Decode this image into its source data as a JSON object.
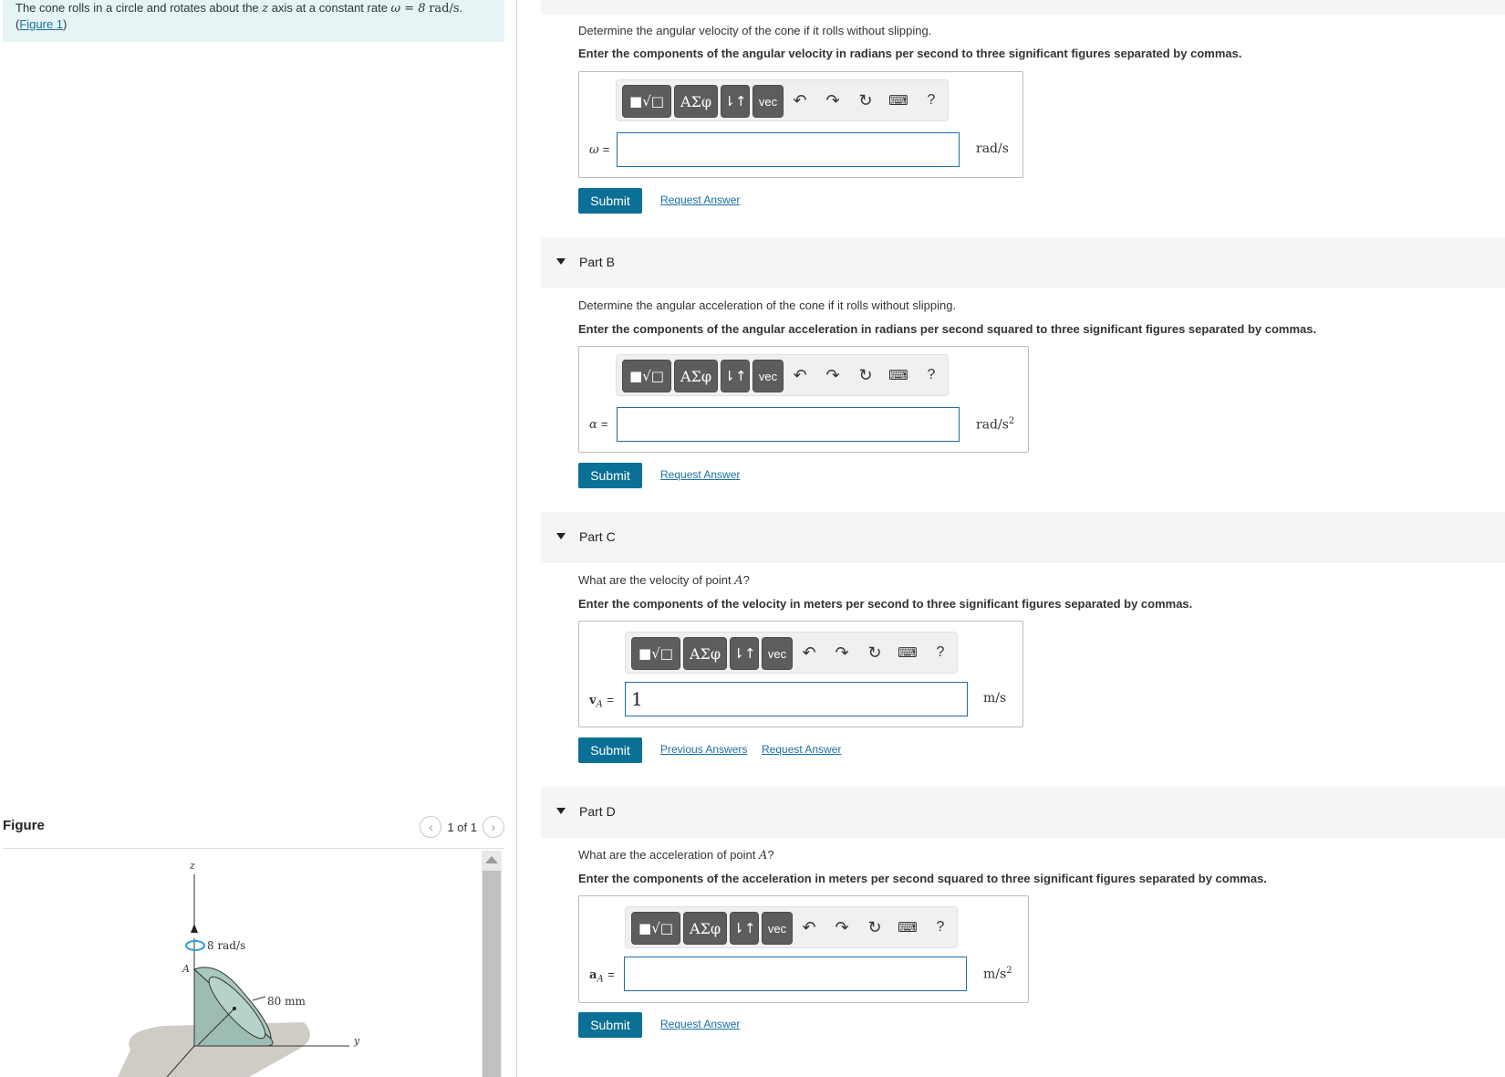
{
  "intro": {
    "text_before": "The cone rolls in a circle and rotates about the ",
    "axis_var": "z",
    "text_mid": " axis at a constant rate ",
    "omega_expr": "ω = 8",
    "omega_unit": "rad/s",
    "period": ".",
    "figure_link_open": "(",
    "figure_link": "Figure 1",
    "figure_link_close": ")"
  },
  "figure": {
    "title": "Figure",
    "page_indicator": "1 of 1",
    "prev_icon": "chevron-left-icon",
    "next_icon": "chevron-right-icon",
    "labels": {
      "z_axis": "z",
      "y_axis": "y",
      "point": "A",
      "rate": "8 rad/s",
      "dimension": "80 mm"
    }
  },
  "toolbar": {
    "templates_label": "■√□",
    "greek_label": "ΑΣφ",
    "subscript_label": "⇂↑",
    "vec_label": "vec",
    "undo_icon": "undo-icon",
    "redo_icon": "redo-icon",
    "reset_icon": "reset-icon",
    "keyboard_icon": "keyboard-icon",
    "help_label": "?"
  },
  "part_a": {
    "question": "Determine the angular velocity of the cone if it rolls without slipping.",
    "instruction": "Enter the components of the angular velocity in radians per second to three significant figures separated by commas.",
    "variable": "ω",
    "eq": "=",
    "value": "",
    "unit": "rad/s",
    "submit": "Submit",
    "request": "Request Answer"
  },
  "part_b": {
    "title": "Part B",
    "question": "Determine the angular acceleration of the cone if it rolls without slipping.",
    "instruction": "Enter the components of the angular acceleration in radians per second squared to three significant figures separated by commas.",
    "variable": "α",
    "eq": "=",
    "value": "",
    "unit": "rad/s",
    "unit_exp": "2",
    "submit": "Submit",
    "request": "Request Answer"
  },
  "part_c": {
    "title": "Part C",
    "question_before": "What are the velocity of point ",
    "question_var": "A",
    "question_after": "?",
    "instruction": "Enter the components of the velocity in meters per second to three significant figures separated by commas.",
    "variable": "v",
    "variable_sub": "A",
    "eq": "=",
    "value": "1",
    "unit": "m/s",
    "submit": "Submit",
    "previous": "Previous Answers",
    "request": "Request Answer"
  },
  "part_d": {
    "title": "Part D",
    "question_before": "What are the acceleration of point ",
    "question_var": "A",
    "question_after": "?",
    "instruction": "Enter the components of the acceleration in meters per second squared to three significant figures separated by commas.",
    "variable": "a",
    "variable_sub": "A",
    "eq": "=",
    "value": "",
    "unit": "m/s",
    "unit_exp": "2",
    "submit": "Submit",
    "request": "Request Answer"
  },
  "colors": {
    "submit_bg": "#0b7095",
    "link": "#1a6fa3",
    "input_border": "#1f6ea6",
    "intro_bg": "#e6f4f5",
    "toolbar_button": "#5d5d5d"
  }
}
